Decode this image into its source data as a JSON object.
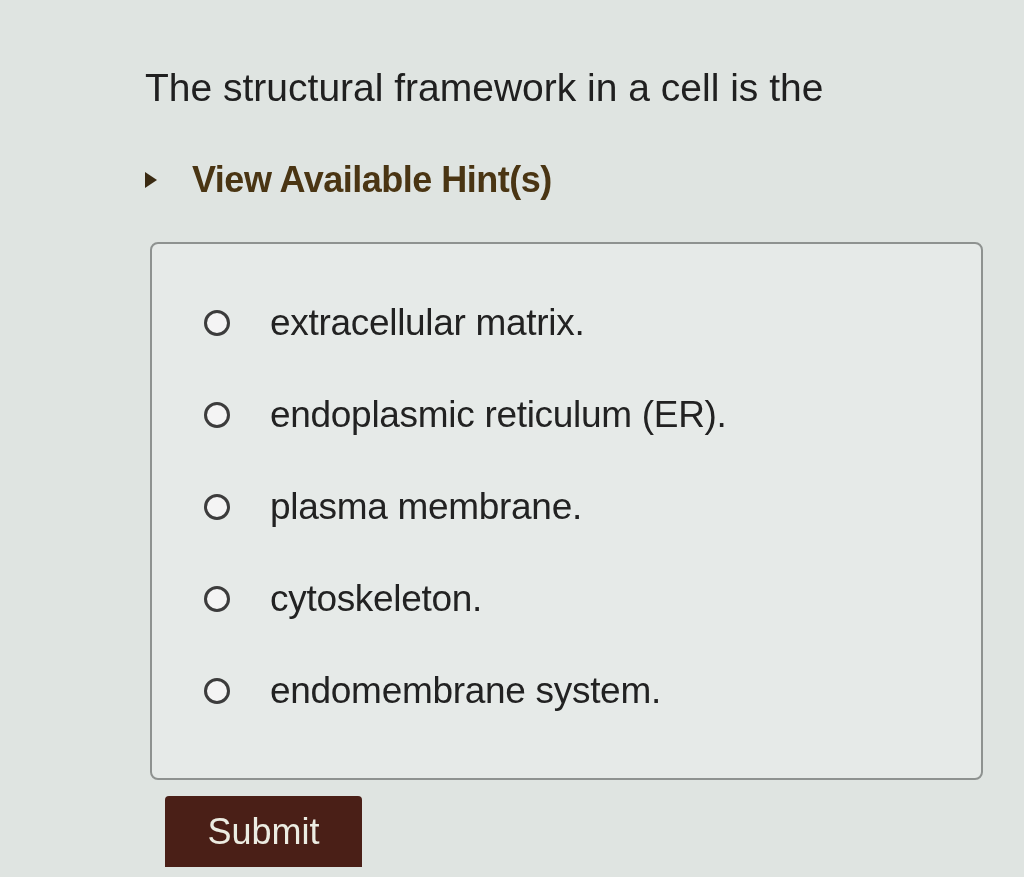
{
  "question": {
    "text": "The structural framework in a cell is the"
  },
  "hint_toggle": {
    "label": "View Available Hint(s)",
    "expanded": false
  },
  "options": [
    {
      "label": "extracellular matrix.",
      "selected": false
    },
    {
      "label": "endoplasmic reticulum (ER).",
      "selected": false
    },
    {
      "label": "plasma membrane.",
      "selected": false
    },
    {
      "label": "cytoskeleton.",
      "selected": false
    },
    {
      "label": "endomembrane system.",
      "selected": false
    }
  ],
  "submit_button": {
    "label": "Submit"
  }
}
